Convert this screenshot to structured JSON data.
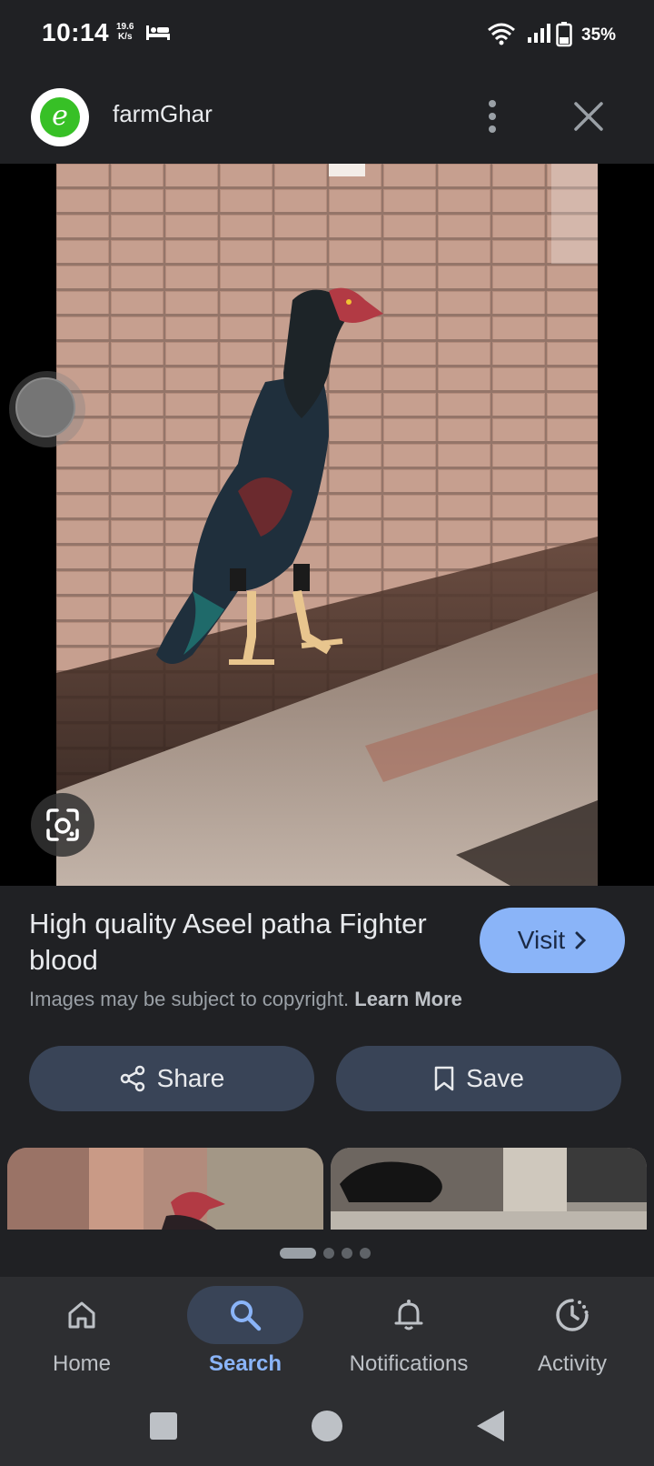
{
  "status_bar": {
    "time": "10:14",
    "net_speed_value": "19.6",
    "net_speed_unit": "K/s",
    "battery": "35%"
  },
  "header": {
    "site_name": "farmGhar",
    "logo_letter": "e"
  },
  "result": {
    "title": "High quality Aseel patha Fighter blood",
    "visit_label": "Visit",
    "copyright_text": "Images may be subject to copyright.",
    "learn_more": "Learn More"
  },
  "actions": {
    "share_label": "Share",
    "save_label": "Save"
  },
  "bottom_nav": {
    "items": [
      {
        "label": "Home",
        "icon": "home-icon"
      },
      {
        "label": "Search",
        "icon": "search-icon",
        "selected": true
      },
      {
        "label": "Notifications",
        "icon": "bell-icon"
      },
      {
        "label": "Activity",
        "icon": "activity-icon"
      }
    ]
  },
  "colors": {
    "background": "#202124",
    "accent": "#8ab4f8",
    "pill": "#394457",
    "logo_green": "#37c026"
  }
}
